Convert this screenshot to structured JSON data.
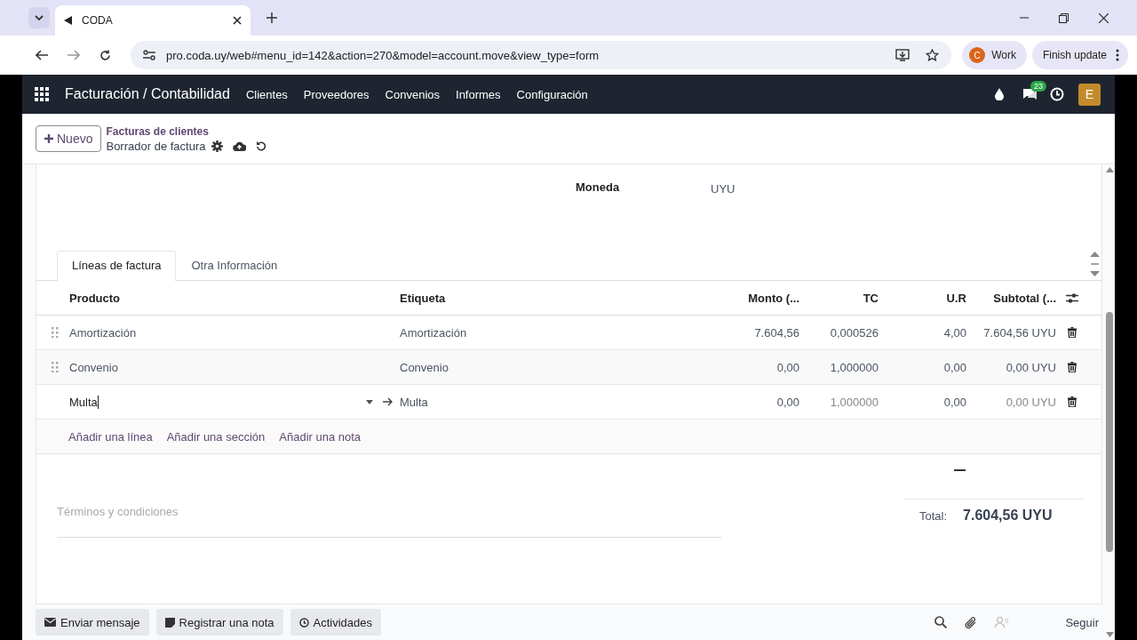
{
  "browser": {
    "tabs": [
      {
        "title": "CODA",
        "selected": true
      }
    ],
    "url": "pro.coda.uy/web#menu_id=142&action=270&model=account.move&view_type=form",
    "profile": {
      "initial": "C",
      "name": "Work"
    },
    "update": "Finish update"
  },
  "navbar": {
    "app": "Facturación / Contabilidad",
    "menu": [
      "Clientes",
      "Proveedores",
      "Convenios",
      "Informes",
      "Configuración"
    ],
    "messages_badge": "23",
    "avatar": "E"
  },
  "control_panel": {
    "new_button": "Nuevo",
    "breadcrumb": "Facturas de clientes",
    "current": "Borrador de factura"
  },
  "form": {
    "fields": [
      {
        "label": "Moneda",
        "value": "UYU"
      }
    ],
    "tabs": [
      {
        "label": "Líneas de factura",
        "selected": true
      },
      {
        "label": "Otra Información",
        "selected": false
      }
    ],
    "table": {
      "columns": [
        "Producto",
        "Etiqueta",
        "Monto (...",
        "TC",
        "U.R",
        "Subtotal (..."
      ],
      "rows": [
        {
          "editing": false,
          "producto": "Amortización",
          "etiqueta": "Amortización",
          "monto": "7.604,56",
          "tc": "0,000526",
          "ur": "4,00",
          "subtotal": "7.604,56 UYU"
        },
        {
          "editing": false,
          "producto": "Convenio",
          "etiqueta": "Convenio",
          "monto": "0,00",
          "tc": "1,000000",
          "ur": "0,00",
          "subtotal": "0,00 UYU"
        },
        {
          "editing": true,
          "producto": "Multa",
          "etiqueta": "Multa",
          "monto": "0,00",
          "tc": "1,000000",
          "ur": "0,00",
          "subtotal": "0,00 UYU"
        }
      ],
      "add_links": [
        "Añadir una línea",
        "Añadir una sección",
        "Añadir una nota"
      ]
    },
    "terms": {
      "placeholder": "Términos y condiciones"
    },
    "total": {
      "label": "Total:",
      "value": "7.604,56 UYU"
    }
  },
  "chatter": {
    "buttons": [
      "Enviar mensaje",
      "Registrar una nota",
      "Actividades"
    ],
    "followers": "0",
    "follow": "Seguir"
  }
}
